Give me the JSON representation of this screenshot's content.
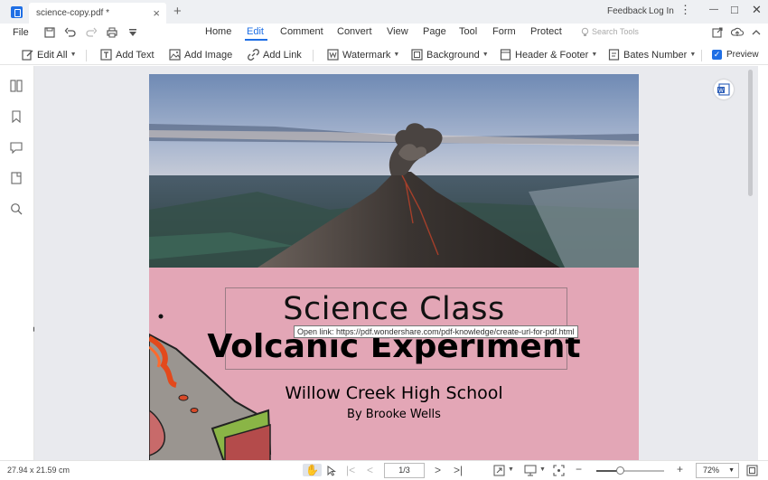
{
  "tab": {
    "title": "science-copy.pdf *",
    "close": "×",
    "new_tab": "+"
  },
  "titlebar": {
    "feedback": "Feedback",
    "login": "Log In",
    "more": "⋮",
    "minimize": "—",
    "maximize": "□",
    "close": "✕"
  },
  "menu": {
    "file": "File",
    "items": [
      "Home",
      "Edit",
      "Comment",
      "Convert",
      "View",
      "Page",
      "Tool",
      "Form",
      "Protect"
    ],
    "active": "Edit",
    "search_placeholder": "Search Tools"
  },
  "toolbar": {
    "edit_all": "Edit All",
    "add_text": "Add Text",
    "add_image": "Add Image",
    "add_link": "Add Link",
    "watermark": "Watermark",
    "background": "Background",
    "header_footer": "Header & Footer",
    "bates_number": "Bates Number",
    "preview": "Preview",
    "preview_checked": true
  },
  "page": {
    "title1": "Science Class",
    "title2": "Volcanic Experiment",
    "school": "Willow Creek High School",
    "author": "By Brooke Wells",
    "tooltip": "Open link: https://pdf.wondershare.com/pdf-knowledge/create-url-for-pdf.html",
    "background_color": "#e3a6b6"
  },
  "status": {
    "page_size": "27.94 x 21.59 cm",
    "page_indicator": "1/3",
    "zoom": "72%",
    "zoom_fraction": 0.35
  },
  "colors": {
    "accent": "#1f6fe5"
  }
}
